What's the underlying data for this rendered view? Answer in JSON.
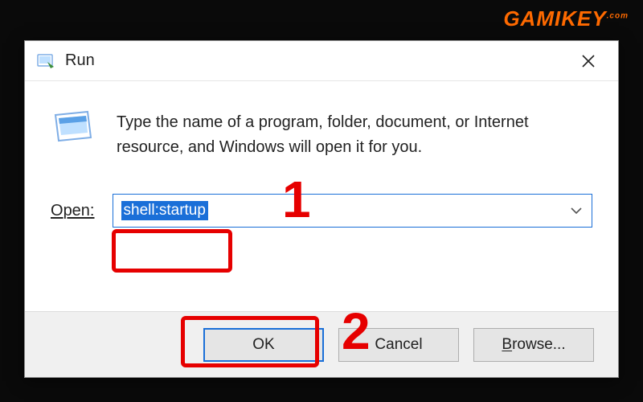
{
  "watermark": "GAMIKEY",
  "watermark_sub": ".com",
  "dialog": {
    "title": "Run",
    "description": "Type the name of a program, folder, document, or Internet resource, and Windows will open it for you.",
    "open_label": "Open:",
    "open_value": "shell:startup",
    "buttons": {
      "ok": "OK",
      "cancel": "Cancel",
      "browse": "Browse..."
    }
  },
  "annotations": {
    "step1": "1",
    "step2": "2"
  }
}
